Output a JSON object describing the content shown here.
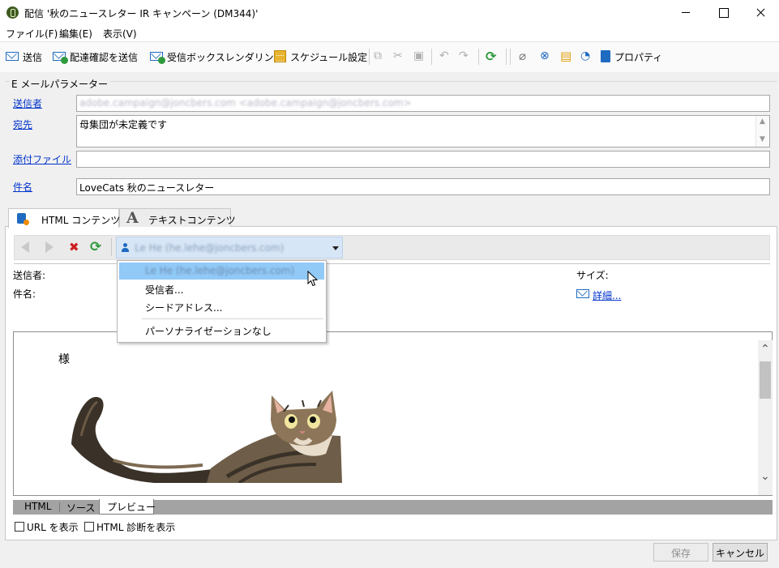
{
  "window": {
    "title": "配信 '秋のニュースレター IR キャンペーン (DM344)'"
  },
  "menu": {
    "file": "ファイル(F)",
    "edit": "編集(E)",
    "view": "表示(V)"
  },
  "toolbar": {
    "send": "送信",
    "send_proof": "配達確認を送信",
    "inbox_rendering": "受信ボックスレンダリング",
    "schedule": "スケジュール設定",
    "properties": "プロパティ"
  },
  "email_params": {
    "legend": "E メールパラメーター",
    "sender_label": "送信者",
    "sender_value": "adobe.campaign@joncbers.com <adobe.campaign@joncbers.com>",
    "to_label": "宛先",
    "to_value": "母集団が未定義です",
    "attachment_label": "添付ファイル",
    "attachment_value": "",
    "subject_label": "件名",
    "subject_value": "LoveCats 秋のニュースレター"
  },
  "tabs": {
    "html": "HTML コンテンツ",
    "text": "テキストコンテンツ"
  },
  "preview": {
    "recipient_selected": "Le He (he.lehe@joncbers.com)",
    "sender_label": "送信者:",
    "subject_label": "件名:",
    "size_label": "サイズ:",
    "details_link": "詳細...",
    "greeting": "様"
  },
  "dropdown": {
    "items": [
      "Le He (he.lehe@joncbers.com)",
      "受信者...",
      "シードアドレス...",
      "パーソナライゼーションなし"
    ]
  },
  "bottom_tabs": {
    "html": "HTML",
    "source": "ソース",
    "preview": "プレビュー"
  },
  "options": {
    "show_url": "URL を表示",
    "show_html_diag": "HTML 診断を表示"
  },
  "buttons": {
    "save": "保存",
    "cancel": "キャンセル"
  }
}
